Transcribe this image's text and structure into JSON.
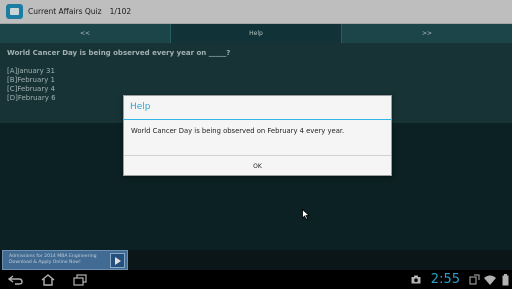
{
  "actionbar": {
    "app_icon": "quiz-app-icon",
    "title": "Current Affairs Quiz",
    "counter": "1/102"
  },
  "navbar": {
    "prev_label": "<<",
    "help_label": "Help",
    "next_label": ">>"
  },
  "question": {
    "text": "World Cancer Day is being observed every year on _____?",
    "options": [
      "[A]January 31",
      "[B]February 1",
      "[C]February 4",
      "[D]February 6"
    ]
  },
  "ad": {
    "text": "Admissions for 2014 MBA Engineering Download & Apply Online Now!",
    "arrow_icon": "arrow-right-icon"
  },
  "dialog": {
    "title": "Help",
    "message": "World Cancer Day is being observed on February 4 every year.",
    "ok_label": "OK"
  },
  "systembar": {
    "clock": "2:55",
    "accent_color": "#33b5e5",
    "left_icons": [
      "back-icon",
      "home-icon",
      "recent-apps-icon"
    ],
    "right_icons": [
      "camera-icon",
      "screen-rotate-icon",
      "wifi-icon",
      "battery-icon"
    ]
  }
}
